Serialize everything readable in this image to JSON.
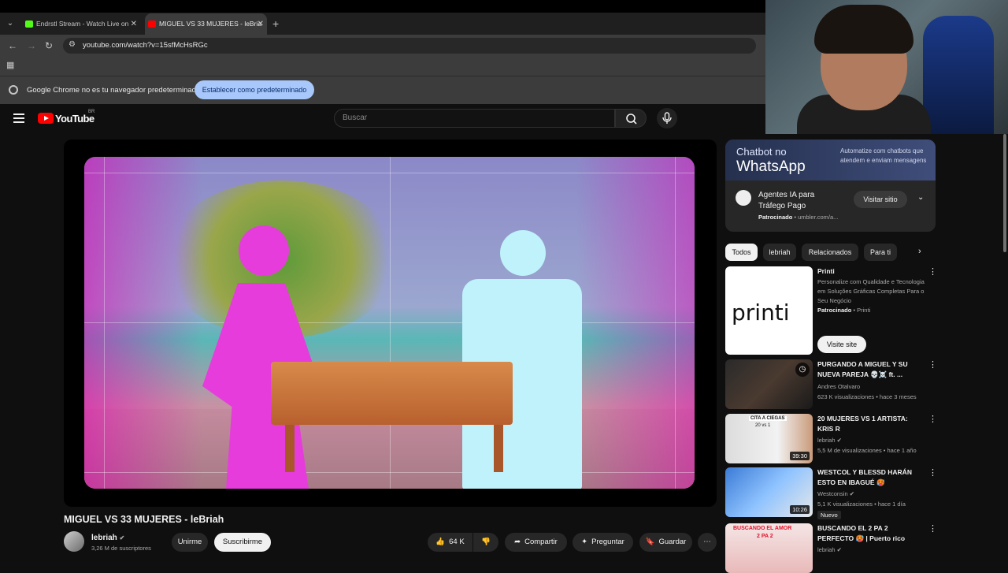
{
  "browser": {
    "tabs": [
      {
        "title": "Endrstl Stream - Watch Live on",
        "favicon_color": "#53fc18"
      },
      {
        "title": "MIGUEL VS 33 MUJERES - leBria",
        "favicon_color": "#ff0000"
      }
    ],
    "url": "youtube.com/watch?v=15sfMcHsRGc",
    "infobar_message": "Google Chrome no es tu navegador predeterminado",
    "infobar_button": "Establecer como predeterminado"
  },
  "youtube": {
    "logo_text": "YouTube",
    "country_code": "BR",
    "search_placeholder": "Buscar"
  },
  "video": {
    "title": "MIGUEL VS 33 MUJERES - leBriah",
    "channel": "lebriah",
    "subscribers": "3,26 M de suscriptores",
    "join_label": "Unirme",
    "subscribe_label": "Suscribirme",
    "likes": "64 K",
    "share_label": "Compartir",
    "ask_label": "Preguntar",
    "save_label": "Guardar"
  },
  "ad": {
    "banner_line1": "Chatbot no",
    "banner_line2": "WhatsApp",
    "banner_desc": "Automatize com chatbots que atendem e enviam mensagens",
    "title": "Agentes IA para Tráfego Pago",
    "sponsored": "Patrocinado",
    "domain": "umbler.com/a...",
    "visit_label": "Visitar sitio"
  },
  "chips": [
    "Todos",
    "lebriah",
    "Relacionados",
    "Para ti"
  ],
  "sponsored_card": {
    "title": "Printi",
    "desc": "Personalize com Qualidade e Tecnologia em Soluções Gráficas Completas Para o Seu Negócio",
    "sponsored": "Patrocinado",
    "advertiser": "Printi",
    "logo_text": "printi",
    "cta": "Visite site"
  },
  "recommendations": [
    {
      "title": "PURGANDO A MIGUEL Y SU NUEVA PAREJA 💀☠️ ft. ...",
      "channel": "Andres Otalvaro",
      "meta": "623 K visualizaciones • hace 3 meses",
      "duration": "",
      "badge": ""
    },
    {
      "title": "20 MUJERES VS 1 ARTISTA: KRIS R",
      "channel": "lebriah",
      "meta": "5,5 M de visualizaciones • hace 1 año",
      "duration": "39:30",
      "badge": ""
    },
    {
      "title": "WESTCOL Y BLESSD HARÁN ESTO EN IBAGUÉ 🥵",
      "channel": "Westconsin",
      "meta": "5,1 K visualizaciones • hace 1 día",
      "duration": "10:26",
      "badge": "Nuevo"
    },
    {
      "title": "BUSCANDO EL 2 PA 2 PERFECTO 🥵 | Puerto rico",
      "channel": "lebriah",
      "meta": "",
      "duration": "",
      "badge": ""
    }
  ],
  "thumb_texts": {
    "blind": "CITA A CIEGAS",
    "blind_sub": "20 vs 1",
    "love": "BUSCANDO EL AMOR",
    "love_sub": "2 PA 2"
  }
}
